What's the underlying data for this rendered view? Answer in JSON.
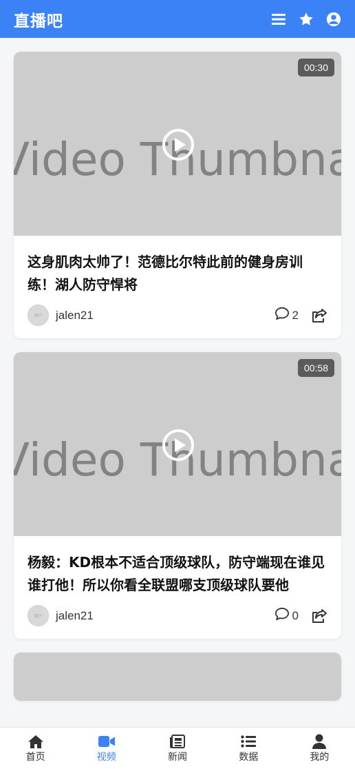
{
  "header": {
    "title": "直播吧",
    "icons": [
      "menu-icon",
      "star-icon",
      "user-circle-icon"
    ]
  },
  "colors": {
    "brand": "#3b82f6",
    "tab_active": "#3b82f6",
    "thumb_bg": "#cdcdcd"
  },
  "videos": [
    {
      "watermark": "Video Thumbnail",
      "duration": "00:30",
      "title": "这身肌肉太帅了！范德比尔特此前的健身房训练！湖人防守悍将",
      "avatar_text": "用户",
      "author": "jalen21",
      "comments": "2"
    },
    {
      "watermark": "Video Thumbnail",
      "duration": "00:58",
      "title": "杨毅：KD根本不适合顶级球队，防守端现在谁见谁打他！所以你看全联盟哪支顶级球队要他",
      "avatar_text": "用户",
      "author": "jalen21",
      "comments": "0"
    }
  ],
  "tabs": [
    {
      "label": "首页",
      "icon": "home-icon"
    },
    {
      "label": "视频",
      "icon": "video-icon",
      "active": true
    },
    {
      "label": "新闻",
      "icon": "newspaper-icon"
    },
    {
      "label": "数据",
      "icon": "list-icon"
    },
    {
      "label": "我的",
      "icon": "user-icon"
    }
  ]
}
